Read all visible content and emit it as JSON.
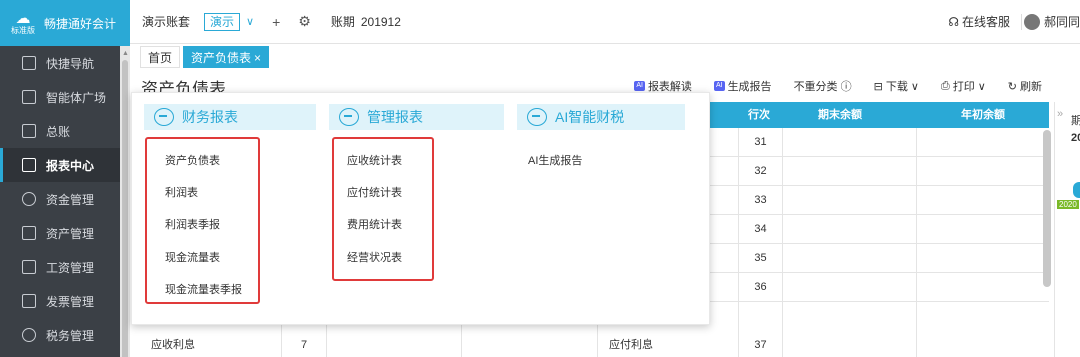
{
  "brand": {
    "name": "畅捷通好会计",
    "edition": "标准版"
  },
  "sidebar": {
    "items": [
      {
        "label": "快捷导航",
        "icon": "home-icon"
      },
      {
        "label": "智能体广场",
        "icon": "grid-icon"
      },
      {
        "label": "总账",
        "icon": "ledger-icon"
      },
      {
        "label": "报表中心",
        "icon": "chart-icon",
        "active": true
      },
      {
        "label": "资金管理",
        "icon": "money-icon"
      },
      {
        "label": "资产管理",
        "icon": "asset-icon"
      },
      {
        "label": "工资管理",
        "icon": "salary-icon"
      },
      {
        "label": "发票管理",
        "icon": "invoice-icon"
      },
      {
        "label": "税务管理",
        "icon": "tax-icon"
      }
    ]
  },
  "topbar": {
    "account_name": "演示账套",
    "account_select": "演示",
    "period_label": "账期",
    "period_value": "201912",
    "service_label": "在线客服",
    "user_name": "郝同同"
  },
  "tabs": [
    {
      "label": "首页",
      "active": false
    },
    {
      "label": "资产负债表",
      "active": true,
      "close": "×"
    }
  ],
  "page": {
    "title": "资产负债表"
  },
  "toolbar": {
    "ai_badge": "AI",
    "report_explain": "报表解读",
    "generate_report": "生成报告",
    "no_reclass": "不重分类 ⓘ",
    "download": "下载",
    "print": "打印",
    "refresh": "刷新"
  },
  "table": {
    "headers": {
      "line_no": "行次",
      "end_balance": "期末余额",
      "begin_balance": "年初余额"
    },
    "rows": [
      {
        "left_item": "",
        "left_no": "",
        "right_item": "",
        "right_no": "31"
      },
      {
        "left_item": "",
        "left_no": "",
        "right_item": "",
        "right_no": "32"
      },
      {
        "left_item": "",
        "left_no": "",
        "right_item": "",
        "right_no": "33"
      },
      {
        "left_item": "",
        "left_no": "",
        "right_item": "",
        "right_no": "34"
      },
      {
        "left_item": "",
        "left_no": "",
        "right_item": "",
        "right_no": "35"
      },
      {
        "left_item": "",
        "left_no": "",
        "right_item": "",
        "right_no": "36"
      },
      {
        "left_item": "应收利息",
        "left_no": "7",
        "right_item": "应付利息",
        "right_no": "37"
      }
    ]
  },
  "right_panel": {
    "line1": "期",
    "line2": "20",
    "badge": "2020"
  },
  "menu": {
    "financial": {
      "title": "财务报表",
      "items": [
        "资产负债表",
        "利润表",
        "利润表季报",
        "现金流量表",
        "现金流量表季报"
      ]
    },
    "management": {
      "title": "管理报表",
      "items": [
        "应收统计表",
        "应付统计表",
        "费用统计表",
        "经营状况表"
      ]
    },
    "ai": {
      "title": "AI智能财税",
      "items": [
        "AI生成报告"
      ]
    }
  },
  "colors": {
    "accent": "#2aa9d6",
    "sidebar": "#3b4046",
    "highlight_box": "#e03a3a"
  }
}
